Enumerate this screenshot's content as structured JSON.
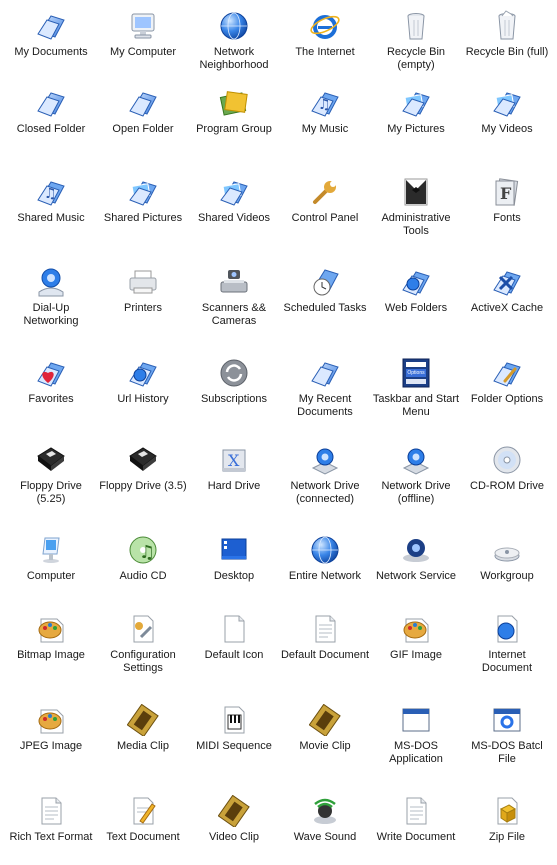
{
  "rows": [
    [
      {
        "label": "My Documents",
        "icon": "folder-documents-icon",
        "kind": "folder"
      },
      {
        "label": "My Computer",
        "icon": "computer-monitor-icon",
        "kind": "monitor"
      },
      {
        "label": "Network\nNeighborhood",
        "icon": "network-globe-icon",
        "kind": "globe"
      },
      {
        "label": "The Internet",
        "icon": "internet-explorer-icon",
        "kind": "ie"
      },
      {
        "label": "Recycle Bin\n(empty)",
        "icon": "recycle-bin-empty-icon",
        "kind": "bin"
      },
      {
        "label": "Recycle Bin (full)",
        "icon": "recycle-bin-full-icon",
        "kind": "binfull"
      }
    ],
    [
      {
        "label": "Closed Folder",
        "icon": "closed-folder-icon",
        "kind": "folder"
      },
      {
        "label": "Open Folder",
        "icon": "open-folder-icon",
        "kind": "folder"
      },
      {
        "label": "Program Group",
        "icon": "program-group-icon",
        "kind": "group"
      },
      {
        "label": "My Music",
        "icon": "music-folder-icon",
        "kind": "musicfolder"
      },
      {
        "label": "My Pictures",
        "icon": "pictures-folder-icon",
        "kind": "picfolder"
      },
      {
        "label": "My Videos",
        "icon": "videos-folder-icon",
        "kind": "picfolder"
      }
    ],
    [
      {
        "label": "Shared Music",
        "icon": "shared-music-icon",
        "kind": "musicfolder"
      },
      {
        "label": "Shared Pictures",
        "icon": "shared-pictures-icon",
        "kind": "picfolder"
      },
      {
        "label": "Shared Videos",
        "icon": "shared-videos-icon",
        "kind": "picfolder"
      },
      {
        "label": "Control Panel",
        "icon": "wrench-icon",
        "kind": "wrench"
      },
      {
        "label": "Administrative\nTools",
        "icon": "tuxedo-icon",
        "kind": "tux"
      },
      {
        "label": "Fonts",
        "icon": "fonts-icon",
        "kind": "fonts"
      }
    ],
    [
      {
        "label": "Dial-Up\nNetworking",
        "icon": "dialup-icon",
        "kind": "dialup"
      },
      {
        "label": "Printers",
        "icon": "printer-icon",
        "kind": "printer"
      },
      {
        "label": "Scanners &&\nCameras",
        "icon": "scanner-camera-icon",
        "kind": "scanner"
      },
      {
        "label": "Scheduled Tasks",
        "icon": "scheduled-tasks-icon",
        "kind": "clockfolder"
      },
      {
        "label": "Web Folders",
        "icon": "web-folders-icon",
        "kind": "globefolder"
      },
      {
        "label": "ActiveX Cache",
        "icon": "activex-cache-icon",
        "kind": "activex"
      }
    ],
    [
      {
        "label": "Favorites",
        "icon": "favorites-icon",
        "kind": "heartfolder"
      },
      {
        "label": "Url History",
        "icon": "url-history-icon",
        "kind": "globefolder"
      },
      {
        "label": "Subscriptions",
        "icon": "subscriptions-icon",
        "kind": "sync"
      },
      {
        "label": "My Recent\nDocuments",
        "icon": "recent-documents-icon",
        "kind": "folder"
      },
      {
        "label": "Taskbar and Start\nMenu",
        "icon": "taskbar-icon",
        "kind": "taskbar",
        "sub": "Options"
      },
      {
        "label": "Folder Options",
        "icon": "folder-options-icon",
        "kind": "wrenchfolder"
      }
    ],
    [
      {
        "label": "Floppy Drive\n(5.25)",
        "icon": "floppy-drive-icon",
        "kind": "floppy"
      },
      {
        "label": "Floppy Drive (3.5)",
        "icon": "floppy-drive-icon",
        "kind": "floppy"
      },
      {
        "label": "Hard Drive",
        "icon": "hard-drive-icon",
        "kind": "hdd"
      },
      {
        "label": "Network Drive\n(connected)",
        "icon": "network-drive-icon",
        "kind": "netdrive"
      },
      {
        "label": "Network Drive\n(offline)",
        "icon": "network-drive-offline-icon",
        "kind": "netdrive"
      },
      {
        "label": "CD-ROM Drive",
        "icon": "cd-rom-icon",
        "kind": "cd"
      }
    ],
    [
      {
        "label": "Computer",
        "icon": "imac-icon",
        "kind": "imac"
      },
      {
        "label": "Audio CD",
        "icon": "audio-cd-icon",
        "kind": "audiocd"
      },
      {
        "label": "Desktop",
        "icon": "desktop-icon",
        "kind": "desktop"
      },
      {
        "label": "Entire Network",
        "icon": "globe-icon",
        "kind": "globe"
      },
      {
        "label": "Network Service",
        "icon": "network-service-icon",
        "kind": "service"
      },
      {
        "label": "Workgroup",
        "icon": "workgroup-icon",
        "kind": "workgroup"
      }
    ],
    [
      {
        "label": "Bitmap Image",
        "icon": "palette-icon",
        "kind": "palette"
      },
      {
        "label": "Configuration\nSettings",
        "icon": "config-settings-icon",
        "kind": "config"
      },
      {
        "label": "Default Icon",
        "icon": "blank-document-icon",
        "kind": "doc"
      },
      {
        "label": "Default Document",
        "icon": "text-document-icon",
        "kind": "doclines"
      },
      {
        "label": "GIF Image",
        "icon": "palette-icon",
        "kind": "palette"
      },
      {
        "label": "Internet\nDocument",
        "icon": "internet-document-icon",
        "kind": "globedoc"
      }
    ],
    [
      {
        "label": "JPEG Image",
        "icon": "palette-icon",
        "kind": "palette"
      },
      {
        "label": "Media Clip",
        "icon": "film-strip-icon",
        "kind": "film"
      },
      {
        "label": "MIDI Sequence",
        "icon": "midi-icon",
        "kind": "midi"
      },
      {
        "label": "Movie Clip",
        "icon": "film-strip-icon",
        "kind": "film"
      },
      {
        "label": "MS-DOS\nApplication",
        "icon": "window-icon",
        "kind": "window"
      },
      {
        "label": "MS-DOS Batcl\nFile",
        "icon": "batch-gear-icon",
        "kind": "batch"
      }
    ],
    [
      {
        "label": "Rich Text Format",
        "icon": "rich-text-icon",
        "kind": "doclines"
      },
      {
        "label": "Text Document",
        "icon": "text-document-pen-icon",
        "kind": "docpen"
      },
      {
        "label": "Video Clip",
        "icon": "film-strip-icon",
        "kind": "film"
      },
      {
        "label": "Wave Sound",
        "icon": "speaker-icon",
        "kind": "wave"
      },
      {
        "label": "Write Document",
        "icon": "write-document-icon",
        "kind": "doclines"
      },
      {
        "label": "Zip File",
        "icon": "zip-file-icon",
        "kind": "zip"
      }
    ]
  ]
}
